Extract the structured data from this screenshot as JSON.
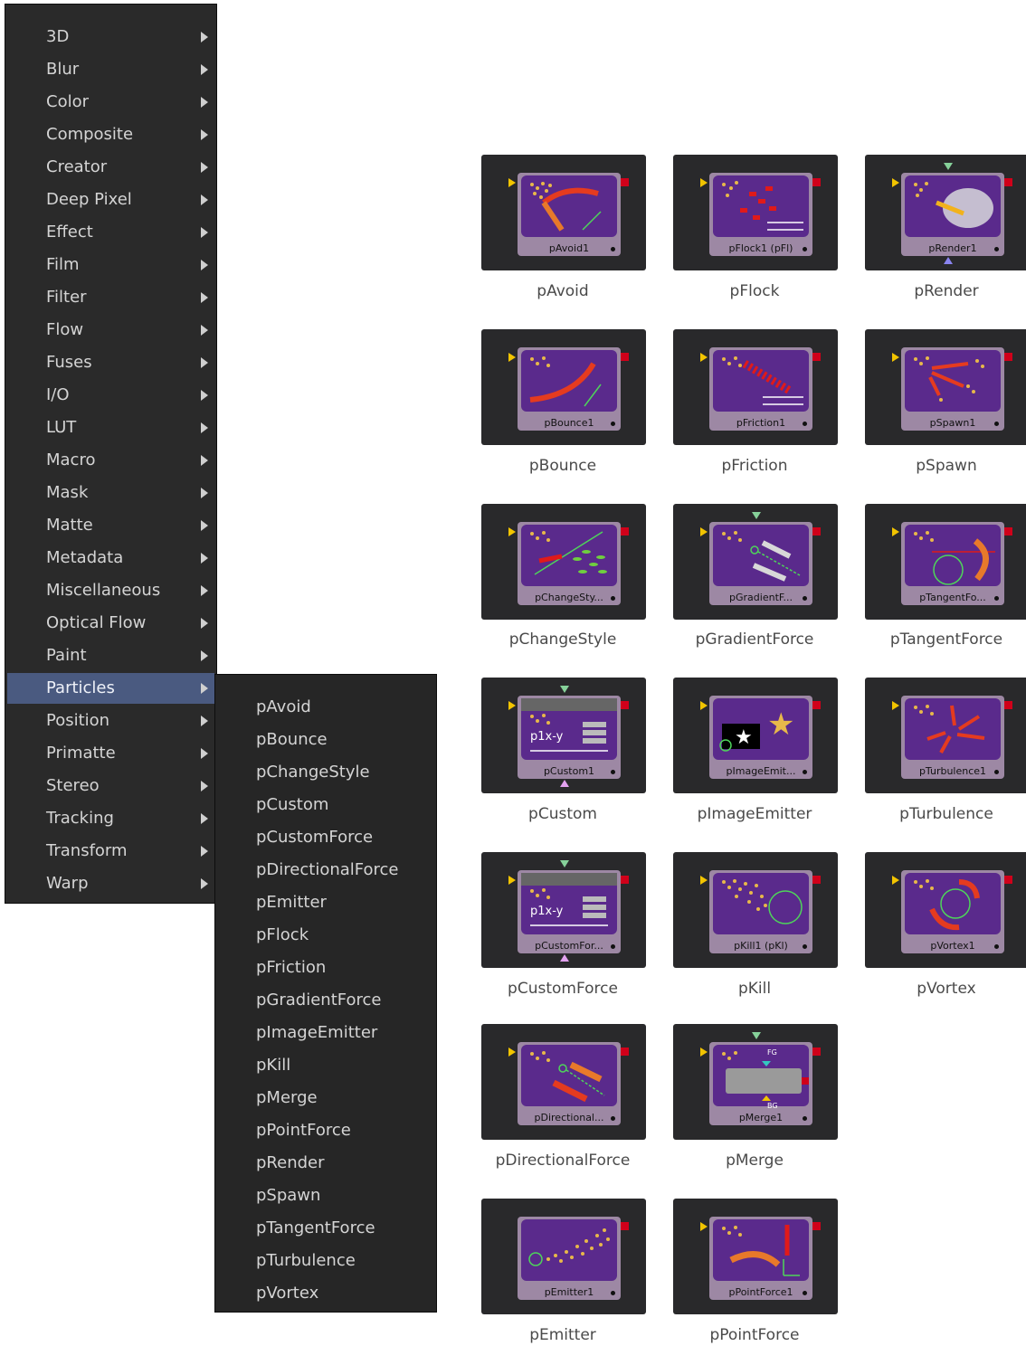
{
  "main_menu": {
    "items": [
      {
        "label": "3D"
      },
      {
        "label": "Blur"
      },
      {
        "label": "Color"
      },
      {
        "label": "Composite"
      },
      {
        "label": "Creator"
      },
      {
        "label": "Deep Pixel"
      },
      {
        "label": "Effect"
      },
      {
        "label": "Film"
      },
      {
        "label": "Filter"
      },
      {
        "label": "Flow"
      },
      {
        "label": "Fuses"
      },
      {
        "label": "I/O"
      },
      {
        "label": "LUT"
      },
      {
        "label": "Macro"
      },
      {
        "label": "Mask"
      },
      {
        "label": "Matte"
      },
      {
        "label": "Metadata"
      },
      {
        "label": "Miscellaneous"
      },
      {
        "label": "Optical Flow"
      },
      {
        "label": "Paint"
      },
      {
        "label": "Particles",
        "active": true
      },
      {
        "label": "Position"
      },
      {
        "label": "Primatte"
      },
      {
        "label": "Stereo"
      },
      {
        "label": "Tracking"
      },
      {
        "label": "Transform"
      },
      {
        "label": "Warp"
      }
    ]
  },
  "particles_submenu": {
    "items": [
      {
        "label": "pAvoid"
      },
      {
        "label": "pBounce"
      },
      {
        "label": "pChangeStyle"
      },
      {
        "label": "pCustom"
      },
      {
        "label": "pCustomForce"
      },
      {
        "label": "pDirectionalForce"
      },
      {
        "label": "pEmitter"
      },
      {
        "label": "pFlock"
      },
      {
        "label": "pFriction"
      },
      {
        "label": "pGradientForce"
      },
      {
        "label": "pImageEmitter"
      },
      {
        "label": "pKill"
      },
      {
        "label": "pMerge"
      },
      {
        "label": "pPointForce"
      },
      {
        "label": "pRender"
      },
      {
        "label": "pSpawn"
      },
      {
        "label": "pTangentForce"
      },
      {
        "label": "pTurbulence"
      },
      {
        "label": "pVortex"
      }
    ]
  },
  "nodes": [
    {
      "node_label": "pAvoid1",
      "caption": "pAvoid",
      "icon": "particles-avoid-icon"
    },
    {
      "node_label": "pFlock1  (pFl)",
      "caption": "pFlock",
      "icon": "particles-flock-icon"
    },
    {
      "node_label": "pRender1",
      "caption": "pRender",
      "icon": "particles-render-icon"
    },
    {
      "node_label": "pBounce1",
      "caption": "pBounce",
      "icon": "particles-bounce-icon"
    },
    {
      "node_label": "pFriction1",
      "caption": "pFriction",
      "icon": "particles-friction-icon"
    },
    {
      "node_label": "pSpawn1",
      "caption": "pSpawn",
      "icon": "particles-spawn-icon"
    },
    {
      "node_label": "pChangeSty...",
      "caption": "pChangeStyle",
      "icon": "particles-changestyle-icon"
    },
    {
      "node_label": "pGradientF...",
      "caption": "pGradientForce",
      "icon": "particles-gradientforce-icon"
    },
    {
      "node_label": "pTangentFo...",
      "caption": "pTangentForce",
      "icon": "particles-tangentforce-icon"
    },
    {
      "node_label": "pCustom1",
      "caption": "pCustom",
      "icon": "particles-custom-icon",
      "glyph_text": "p1x-y"
    },
    {
      "node_label": "pImageEmit...",
      "caption": "pImageEmitter",
      "icon": "particles-imageemitter-icon"
    },
    {
      "node_label": "pTurbulence1",
      "caption": "pTurbulence",
      "icon": "particles-turbulence-icon"
    },
    {
      "node_label": "pCustomFor...",
      "caption": "pCustomForce",
      "icon": "particles-customforce-icon",
      "glyph_text": "p1x-y"
    },
    {
      "node_label": "pKill1  (pKl)",
      "caption": "pKill",
      "icon": "particles-kill-icon"
    },
    {
      "node_label": "pVortex1",
      "caption": "pVortex",
      "icon": "particles-vortex-icon"
    },
    {
      "node_label": "pDirectional...",
      "caption": "pDirectionalForce",
      "icon": "particles-directionalforce-icon"
    },
    {
      "node_label": "pMerge1",
      "caption": "pMerge",
      "icon": "particles-merge-icon",
      "fg_label": "FG",
      "bg_label": "BG"
    },
    {
      "node_label": "pEmitter1",
      "caption": "pEmitter",
      "icon": "particles-emitter-icon"
    },
    {
      "node_label": "pPointForce1",
      "caption": "pPointForce",
      "icon": "particles-pointforce-icon"
    }
  ]
}
